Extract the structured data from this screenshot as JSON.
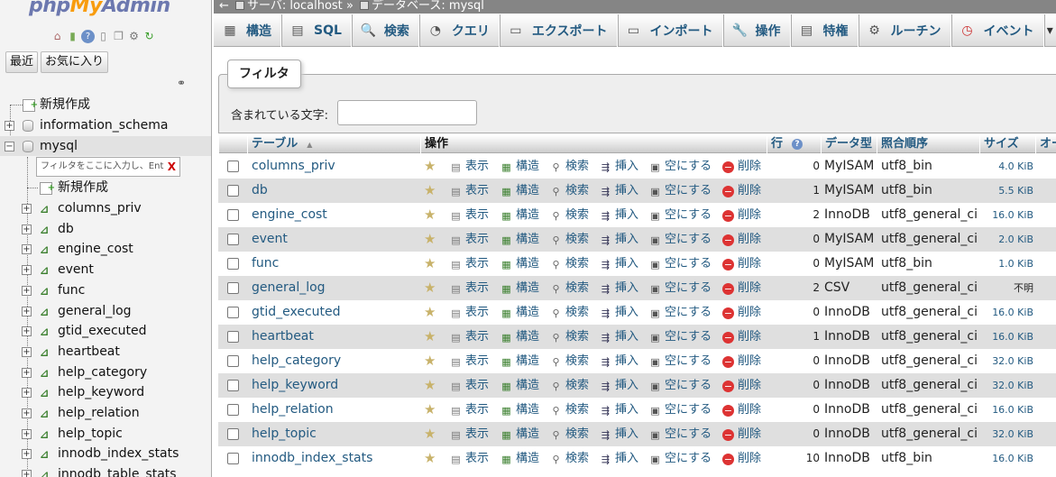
{
  "app": {
    "logo_php": "php",
    "logo_my": "My",
    "logo_admin": "Admin"
  },
  "left": {
    "icons": [
      "home-icon",
      "exit-icon",
      "help-icon",
      "doc-icon",
      "copy-icon",
      "gear-icon",
      "reload-icon"
    ],
    "buttons": {
      "recent": "最近",
      "favorites": "お気に入り"
    },
    "tree": {
      "new": "新規作成",
      "databases": [
        "information_schema",
        "mysql"
      ],
      "mysql_filter_placeholder": "フィルタをここに入力し、Ent",
      "mysql_filter_clear": "X",
      "mysql_new": "新規作成",
      "mysql_tables": [
        "columns_priv",
        "db",
        "engine_cost",
        "event",
        "func",
        "general_log",
        "gtid_executed",
        "heartbeat",
        "help_category",
        "help_keyword",
        "help_relation",
        "help_topic",
        "innodb_index_stats",
        "innodb_table_stats"
      ]
    }
  },
  "breadcrumb": {
    "server": "サーバ: localhost",
    "sep": "»",
    "database": "データベース: mysql"
  },
  "menu": {
    "tabs": [
      {
        "label": "構造",
        "icon": "structure-icon"
      },
      {
        "label": "SQL",
        "icon": "sql-icon"
      },
      {
        "label": "検索",
        "icon": "search-icon"
      },
      {
        "label": "クエリ",
        "icon": "query-icon"
      },
      {
        "label": "エクスポート",
        "icon": "export-icon"
      },
      {
        "label": "インポート",
        "icon": "import-icon"
      },
      {
        "label": "操作",
        "icon": "wrench-icon"
      },
      {
        "label": "特権",
        "icon": "privileges-icon"
      },
      {
        "label": "ルーチン",
        "icon": "routines-icon"
      },
      {
        "label": "イベント",
        "icon": "clock-icon"
      }
    ],
    "more": "▾"
  },
  "filter": {
    "legend": "フィルタ",
    "label": "含まれている文字:",
    "value": ""
  },
  "table": {
    "headers": {
      "table": "テーブル",
      "action": "操作",
      "rows": "行",
      "type": "データ型",
      "collation": "照合順序",
      "size": "サイズ",
      "overhead": "オーバーヘッド"
    },
    "actions": {
      "browse": "表示",
      "structure": "構造",
      "search": "検索",
      "insert": "挿入",
      "empty": "空にする",
      "drop": "削除"
    },
    "rows": [
      {
        "name": "columns_priv",
        "rows": "0",
        "engine": "MyISAM",
        "collation": "utf8_bin",
        "size": "4.0 KiB"
      },
      {
        "name": "db",
        "rows": "1",
        "engine": "MyISAM",
        "collation": "utf8_bin",
        "size": "5.5 KiB"
      },
      {
        "name": "engine_cost",
        "rows": "2",
        "engine": "InnoDB",
        "collation": "utf8_general_ci",
        "size": "16.0 KiB"
      },
      {
        "name": "event",
        "rows": "0",
        "engine": "MyISAM",
        "collation": "utf8_general_ci",
        "size": "2.0 KiB"
      },
      {
        "name": "func",
        "rows": "0",
        "engine": "MyISAM",
        "collation": "utf8_bin",
        "size": "1.0 KiB"
      },
      {
        "name": "general_log",
        "rows": "2",
        "engine": "CSV",
        "collation": "utf8_general_ci",
        "size": "不明"
      },
      {
        "name": "gtid_executed",
        "rows": "0",
        "engine": "InnoDB",
        "collation": "utf8_general_ci",
        "size": "16.0 KiB"
      },
      {
        "name": "heartbeat",
        "rows": "1",
        "engine": "InnoDB",
        "collation": "utf8_general_ci",
        "size": "16.0 KiB"
      },
      {
        "name": "help_category",
        "rows": "0",
        "engine": "InnoDB",
        "collation": "utf8_general_ci",
        "size": "32.0 KiB"
      },
      {
        "name": "help_keyword",
        "rows": "0",
        "engine": "InnoDB",
        "collation": "utf8_general_ci",
        "size": "32.0 KiB"
      },
      {
        "name": "help_relation",
        "rows": "0",
        "engine": "InnoDB",
        "collation": "utf8_general_ci",
        "size": "16.0 KiB"
      },
      {
        "name": "help_topic",
        "rows": "0",
        "engine": "InnoDB",
        "collation": "utf8_general_ci",
        "size": "32.0 KiB"
      },
      {
        "name": "innodb_index_stats",
        "rows": "10",
        "engine": "InnoDB",
        "collation": "utf8_bin",
        "size": "16.0 KiB"
      }
    ]
  }
}
